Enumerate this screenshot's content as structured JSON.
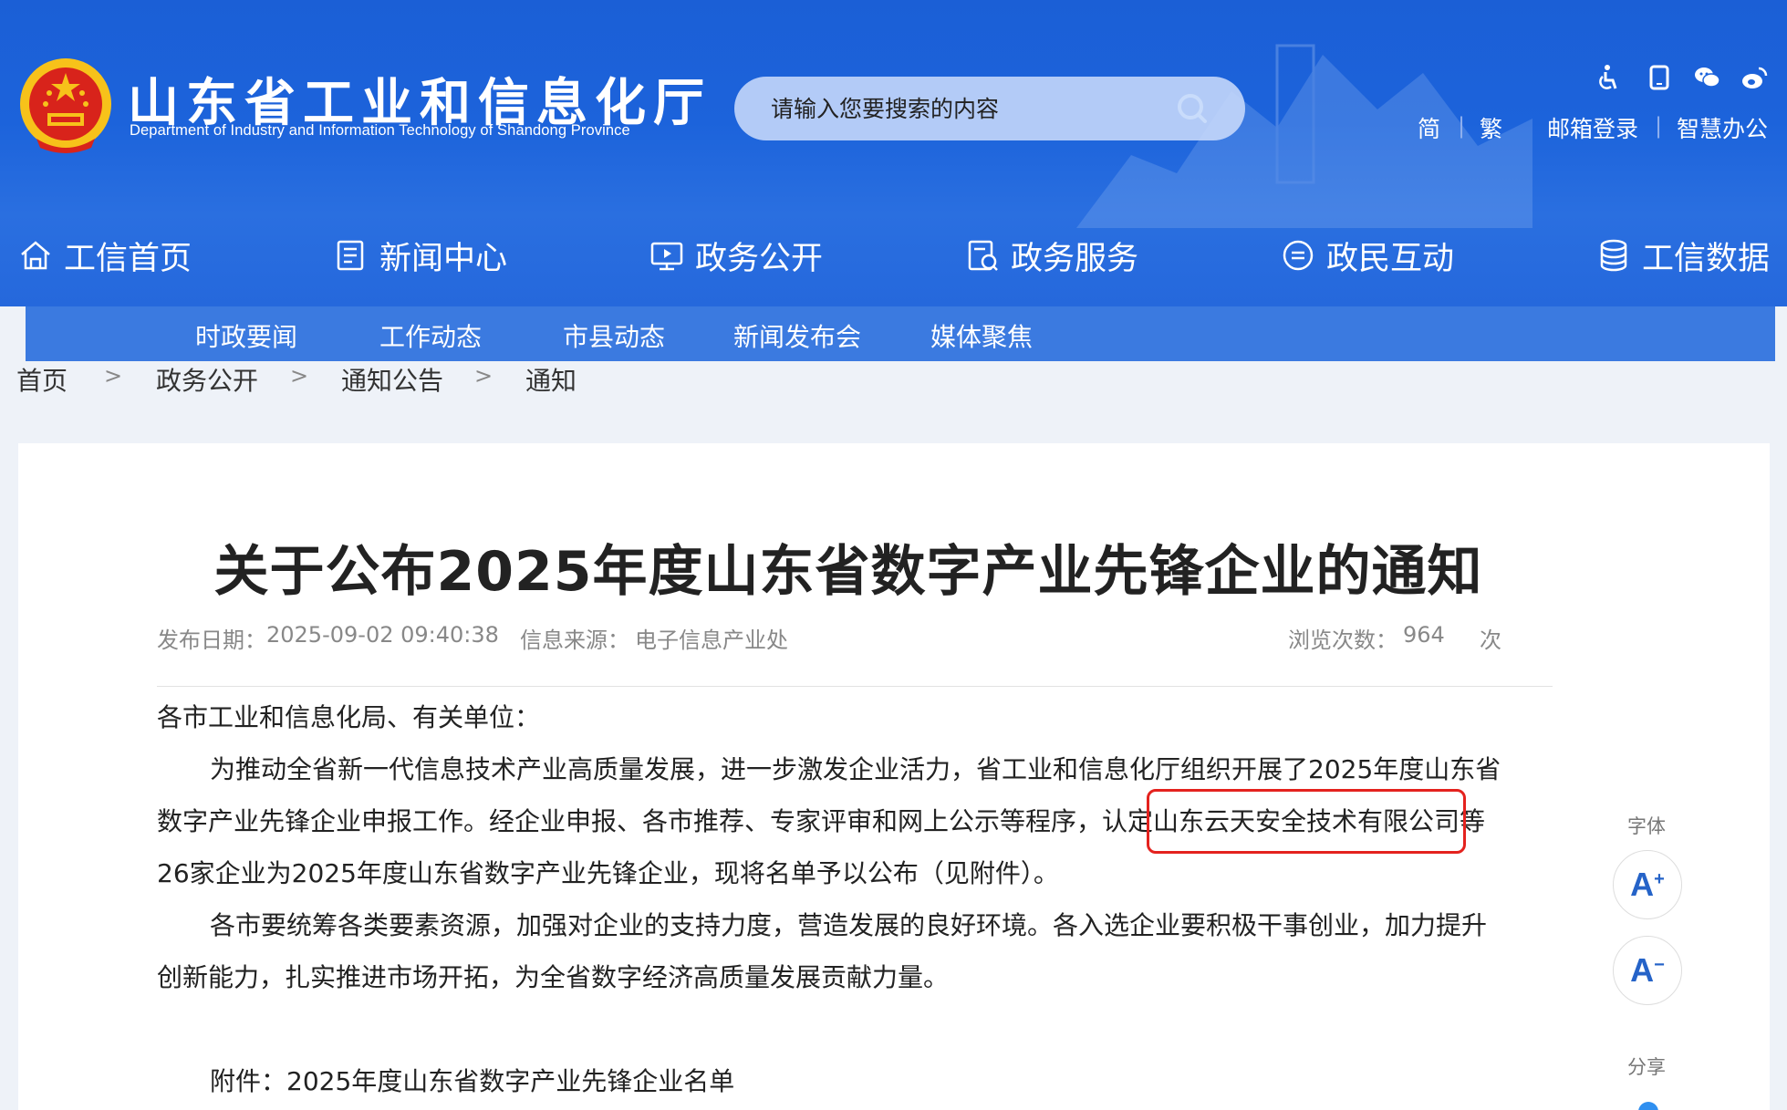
{
  "header": {
    "site_title": "山东省工业和信息化厅",
    "site_subtitle": "Department of Industry and Information Technology of Shandong Province",
    "search_placeholder": "请输入您要搜索的内容",
    "top_links": {
      "simplified": "简",
      "traditional": "繁",
      "mail_login": "邮箱登录",
      "smart_office": "智慧办公",
      "separator": "|"
    },
    "top_icons": [
      "accessibility-icon",
      "mobile-icon",
      "wechat-icon",
      "weibo-icon"
    ]
  },
  "main_nav": [
    {
      "label": "工信首页",
      "icon": "home-icon"
    },
    {
      "label": "新闻中心",
      "icon": "news-icon"
    },
    {
      "label": "政务公开",
      "icon": "screen-icon"
    },
    {
      "label": "政务服务",
      "icon": "service-icon"
    },
    {
      "label": "政民互动",
      "icon": "chat-icon"
    },
    {
      "label": "工信数据",
      "icon": "database-icon"
    }
  ],
  "sub_nav": [
    "时政要闻",
    "工作动态",
    "市县动态",
    "新闻发布会",
    "媒体聚焦"
  ],
  "breadcrumb": {
    "items": [
      "首页",
      "政务公开",
      "通知公告",
      "通知"
    ],
    "separator": ">"
  },
  "article": {
    "title": "关于公布2025年度山东省数字产业先锋企业的通知",
    "publish_label": "发布日期：",
    "publish_date": "2025-09-02 09:40:38",
    "source_label": "信息来源：",
    "source": "电子信息产业处",
    "views_label": "浏览次数：",
    "views": "964",
    "views_unit": "次",
    "salutation": "各市工业和信息化局、有关单位：",
    "p1_line1": "为推动全省新一代信息技术产业高质量发展，进一步激发企业活力，省工业和信息化厅组织开展了2025年度山东省",
    "p1_line2_pre": "数字产业先锋企业申报工作。经企业申报、各市推荐、专家评审和网上公示等程序，认定",
    "p1_highlight": "山东云天安全技术有限公司",
    "p1_line2_post": "等",
    "p1_line3": "26家企业为2025年度山东省数字产业先锋企业，现将名单予以公布（见附件）。",
    "p2_line1": "各市要统筹各类要素资源，加强对企业的支持力度，营造发展的良好环境。各入选企业要积极干事创业，加力提升",
    "p2_line2": "创新能力，扎实推进市场开拓，为全省数字经济高质量发展贡献力量。",
    "attachment": "附件：2025年度山东省数字产业先锋企业名单"
  },
  "side_tools": {
    "font_label": "字体",
    "font_increase": "A",
    "font_increase_sup": "+",
    "font_decrease": "A",
    "font_decrease_sup": "−",
    "share_label": "分享"
  },
  "colors": {
    "header_blue": "#1c63db",
    "subnav_blue": "#3b7ae0",
    "highlight_red": "#e4221e"
  }
}
